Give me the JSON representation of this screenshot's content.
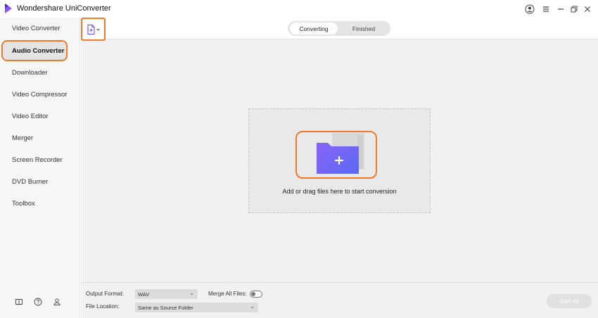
{
  "window": {
    "title": "Wondershare UniConverter",
    "controls": {
      "account_icon": "account-icon",
      "menu_icon": "menu-icon",
      "minimize_icon": "minimize-icon",
      "restore_icon": "restore-icon",
      "close_icon": "close-icon"
    }
  },
  "sidebar": {
    "items": [
      {
        "label": "Video Converter",
        "active": false
      },
      {
        "label": "Audio Converter",
        "active": true
      },
      {
        "label": "Downloader",
        "active": false
      },
      {
        "label": "Video Compressor",
        "active": false
      },
      {
        "label": "Video Editor",
        "active": false
      },
      {
        "label": "Merger",
        "active": false
      },
      {
        "label": "Screen Recorder",
        "active": false
      },
      {
        "label": "DVD Burner",
        "active": false
      },
      {
        "label": "Toolbox",
        "active": false
      }
    ],
    "bottom_icons": [
      "book-icon",
      "help-icon",
      "user-icon"
    ]
  },
  "toolbar": {
    "add_file_icon": "add-file-icon",
    "tabs": [
      {
        "label": "Converting",
        "active": true
      },
      {
        "label": "Finished",
        "active": false
      }
    ]
  },
  "dropzone": {
    "text": "Add or drag files here to start conversion",
    "icon": "folder-plus-icon"
  },
  "bottom": {
    "output_format_label": "Output Format:",
    "output_format_value": "WAV",
    "merge_label": "Merge All Files:",
    "merge_on": false,
    "file_location_label": "File Location:",
    "file_location_value": "Same as Source Folder",
    "start_all_label": "Start All"
  },
  "colors": {
    "highlight": "#f07a2a",
    "folder": "#7b5cf5"
  }
}
